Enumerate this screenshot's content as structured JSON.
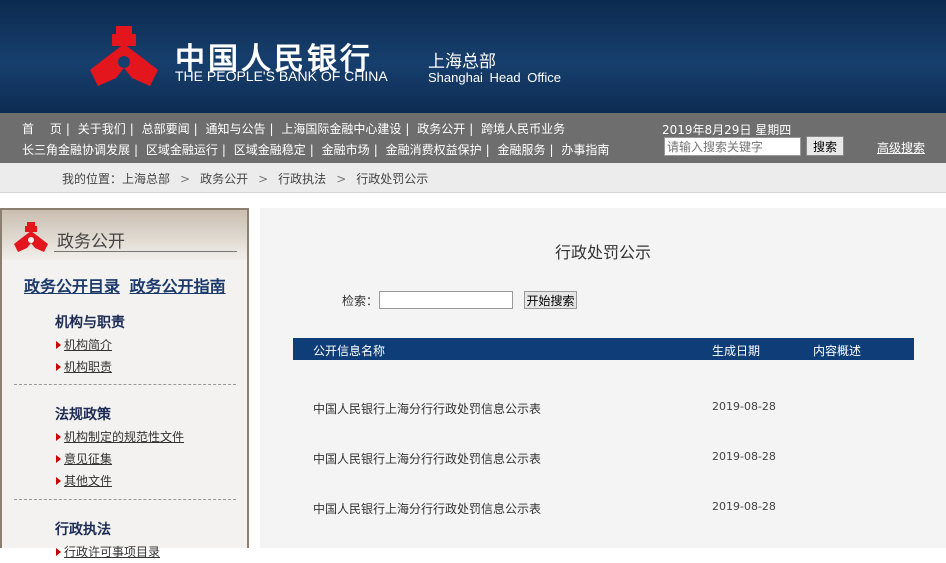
{
  "header": {
    "title_cn": "中国人民银行",
    "title_en": "THE PEOPLE'S BANK OF CHINA",
    "branch_cn": "上海总部",
    "branch_en": "Shanghai Head Office"
  },
  "nav": {
    "row1": [
      "首　 页",
      "关于我们",
      "总部要闻",
      "通知与公告",
      "上海国际金融中心建设",
      "政务公开",
      "跨境人民币业务"
    ],
    "row2": [
      "长三角金融协调发展",
      "区域金融运行",
      "区域金融稳定",
      "金融市场",
      "金融消费权益保护",
      "金融服务",
      "办事指南"
    ],
    "date": "2019年8月29日 星期四",
    "search_placeholder": "请输入搜索关键字",
    "search_button": "搜索",
    "advanced": "高级搜索"
  },
  "breadcrumb": {
    "prefix": "我的位置：",
    "items": [
      "上海总部",
      "政务公开",
      "行政执法",
      "行政处罚公示"
    ]
  },
  "sidebar": {
    "title": "政务公开",
    "links": [
      "政务公开目录",
      "政务公开指南"
    ],
    "sections": [
      {
        "title": "机构与职责",
        "items": [
          "机构简介",
          "机构职责"
        ]
      },
      {
        "title": "法规政策",
        "items": [
          "机构制定的规范性文件",
          "意见征集",
          "其他文件"
        ]
      },
      {
        "title": "行政执法",
        "items": [
          "行政许可事项目录"
        ]
      }
    ]
  },
  "main": {
    "title": "行政处罚公示",
    "search_label": "检索：",
    "search_button": "开始搜索",
    "columns": [
      "公开信息名称",
      "生成日期",
      "内容概述"
    ],
    "rows": [
      {
        "name": "中国人民银行上海分行行政处罚信息公示表",
        "date": "2019-08-28"
      },
      {
        "name": "中国人民银行上海分行行政处罚信息公示表",
        "date": "2019-08-28"
      },
      {
        "name": "中国人民银行上海分行行政处罚信息公示表",
        "date": "2019-08-28"
      }
    ]
  }
}
